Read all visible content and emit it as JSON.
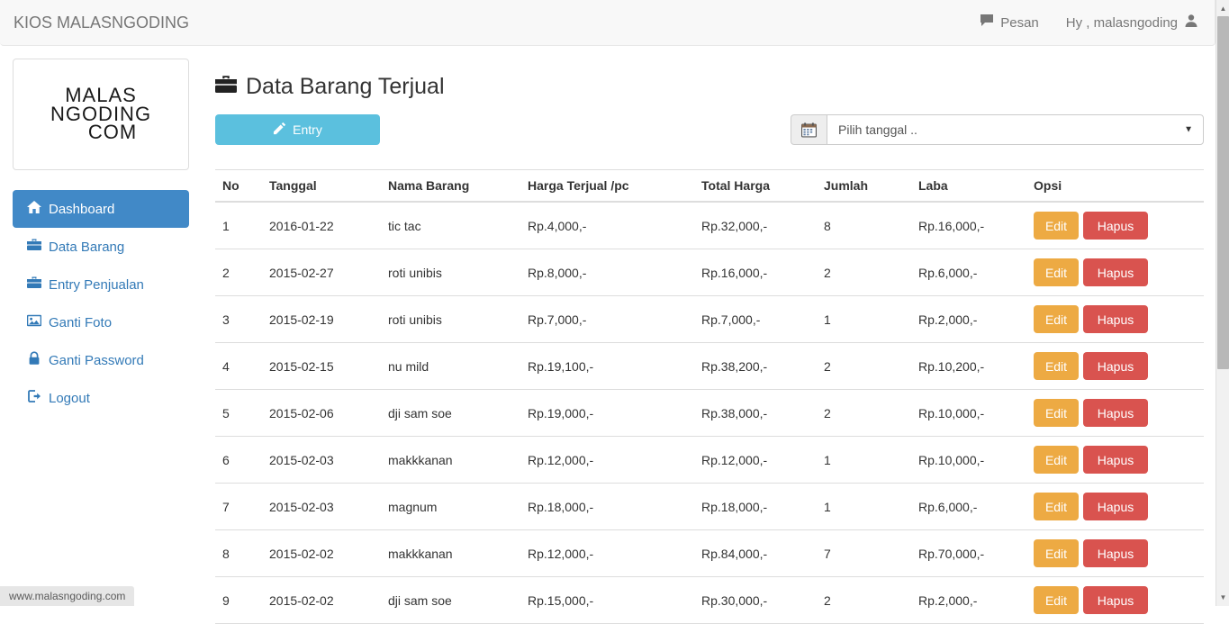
{
  "navbar": {
    "brand": "KIOS MALASNGODING",
    "pesan_label": "Pesan",
    "pesan_icon": "comment-icon",
    "user_greeting": "Hy , malasngoding",
    "user_icon": "user-icon"
  },
  "sidebar": {
    "logo": {
      "line1": "MALAS",
      "line2": "NGODING",
      "line3": "COM"
    },
    "items": [
      {
        "label": "Dashboard",
        "icon": "home-icon",
        "active": true
      },
      {
        "label": "Data Barang",
        "icon": "briefcase-icon",
        "active": false
      },
      {
        "label": "Entry Penjualan",
        "icon": "briefcase-icon",
        "active": false
      },
      {
        "label": "Ganti Foto",
        "icon": "image-icon",
        "active": false
      },
      {
        "label": "Ganti Password",
        "icon": "lock-icon",
        "active": false
      },
      {
        "label": "Logout",
        "icon": "signout-icon",
        "active": false
      }
    ]
  },
  "main": {
    "title": "Data Barang Terjual",
    "title_icon": "briefcase-icon",
    "entry_button": {
      "label": "Entry",
      "icon": "pencil-icon",
      "color": "#5bc0de"
    },
    "date_picker": {
      "addon_icon": "calendar-icon",
      "value": "Pilih tanggal ..",
      "caret": "▼"
    },
    "table": {
      "columns": [
        "No",
        "Tanggal",
        "Nama Barang",
        "Harga Terjual /pc",
        "Total Harga",
        "Jumlah",
        "Laba",
        "Opsi"
      ],
      "actions": {
        "edit": "Edit",
        "hapus": "Hapus",
        "edit_color": "#edaa43",
        "hapus_color": "#d9534f"
      },
      "rows": [
        {
          "no": "1",
          "tanggal": "2016-01-22",
          "nama": "tic tac",
          "harga": "Rp.4,000,-",
          "total": "Rp.32,000,-",
          "jumlah": "8",
          "laba": "Rp.16,000,-"
        },
        {
          "no": "2",
          "tanggal": "2015-02-27",
          "nama": "roti unibis",
          "harga": "Rp.8,000,-",
          "total": "Rp.16,000,-",
          "jumlah": "2",
          "laba": "Rp.6,000,-"
        },
        {
          "no": "3",
          "tanggal": "2015-02-19",
          "nama": "roti unibis",
          "harga": "Rp.7,000,-",
          "total": "Rp.7,000,-",
          "jumlah": "1",
          "laba": "Rp.2,000,-"
        },
        {
          "no": "4",
          "tanggal": "2015-02-15",
          "nama": "nu mild",
          "harga": "Rp.19,100,-",
          "total": "Rp.38,200,-",
          "jumlah": "2",
          "laba": "Rp.10,200,-"
        },
        {
          "no": "5",
          "tanggal": "2015-02-06",
          "nama": "dji sam soe",
          "harga": "Rp.19,000,-",
          "total": "Rp.38,000,-",
          "jumlah": "2",
          "laba": "Rp.10,000,-"
        },
        {
          "no": "6",
          "tanggal": "2015-02-03",
          "nama": "makkkanan",
          "harga": "Rp.12,000,-",
          "total": "Rp.12,000,-",
          "jumlah": "1",
          "laba": "Rp.10,000,-"
        },
        {
          "no": "7",
          "tanggal": "2015-02-03",
          "nama": "magnum",
          "harga": "Rp.18,000,-",
          "total": "Rp.18,000,-",
          "jumlah": "1",
          "laba": "Rp.6,000,-"
        },
        {
          "no": "8",
          "tanggal": "2015-02-02",
          "nama": "makkkanan",
          "harga": "Rp.12,000,-",
          "total": "Rp.84,000,-",
          "jumlah": "7",
          "laba": "Rp.70,000,-"
        },
        {
          "no": "9",
          "tanggal": "2015-02-02",
          "nama": "dji sam soe",
          "harga": "Rp.15,000,-",
          "total": "Rp.30,000,-",
          "jumlah": "2",
          "laba": "Rp.2,000,-"
        }
      ]
    }
  },
  "statusbar": {
    "url": "www.malasngoding.com"
  },
  "scrollbar": {
    "up_arrow": "▲",
    "down_arrow": "▼"
  }
}
